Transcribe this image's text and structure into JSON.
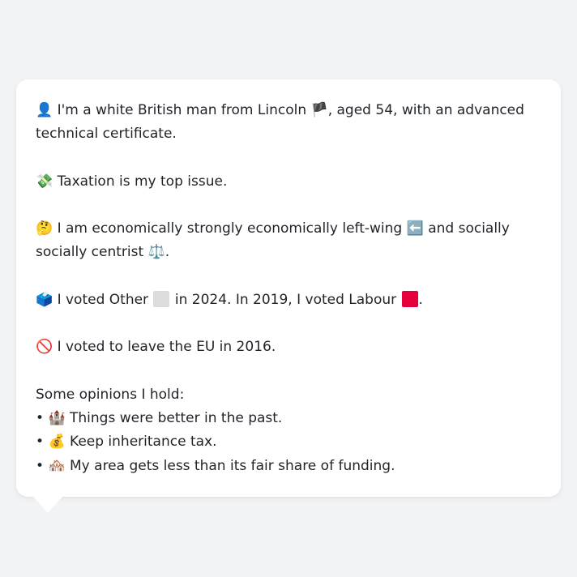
{
  "profile": {
    "intro": {
      "icon": "👤",
      "text_before_flag": "I'm a white British man from Lincoln",
      "flag": "🏴",
      "text_after_flag": ", aged 54, with an advanced technical certificate."
    },
    "issue": {
      "icon": "💸",
      "text": "Taxation is my top issue."
    },
    "ideology": {
      "icon": "🤔",
      "text_part1": "I am economically strongly economically left-wing",
      "left_icon": "⬅️",
      "text_part2": "and socially socially centrist",
      "centre_icon": "⚖️",
      "end": "."
    },
    "votes": {
      "icon": "🗳️",
      "text_part1": "I voted Other",
      "other_color": "#dcdcdc",
      "text_part2": "in 2024. In 2019, I voted Labour",
      "labour_color": "#e4003b",
      "end": "."
    },
    "brexit": {
      "icon": "🚫",
      "text": "I voted to leave the EU in 2016."
    },
    "opinions": {
      "heading": "Some opinions I hold:",
      "bullet": "•",
      "items": [
        {
          "icon": "🏰",
          "text": "Things were better in the past."
        },
        {
          "icon": "💰",
          "text": "Keep inheritance tax."
        },
        {
          "icon": "🏘️",
          "text": "My area gets less than its fair share of funding."
        }
      ]
    }
  }
}
